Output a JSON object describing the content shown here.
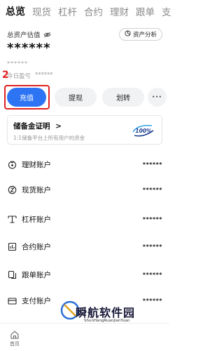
{
  "tabs": [
    "总览",
    "现货",
    "杠杆",
    "合约",
    "理财",
    "跟单",
    "支"
  ],
  "header": {
    "total_label": "总资产估值",
    "analysis_label": "资产分析",
    "masked_value": "******",
    "masked_small": "******",
    "pnl_label": "今日盈亏",
    "pnl_value": "******"
  },
  "annotation": {
    "step": "2"
  },
  "actions": {
    "recharge": "充值",
    "withdraw": "提现",
    "transfer": "划转",
    "more": "···"
  },
  "reserve": {
    "title": "储备金证明",
    "chevron": ">",
    "subtitle": "1:1储备平台上所有用户的资金",
    "badge": "100%"
  },
  "accounts": [
    {
      "name": "理财账户",
      "value": "******",
      "icon": "savings-icon"
    },
    {
      "name": "现货账户",
      "value": "******",
      "icon": "spot-icon"
    },
    {
      "name": "杠杆账户",
      "value": "******",
      "icon": "margin-icon"
    },
    {
      "name": "合约账户",
      "value": "******",
      "icon": "futures-icon"
    },
    {
      "name": "跟单账户",
      "value": "******",
      "icon": "copytrade-icon"
    },
    {
      "name": "支付账户",
      "value": "******",
      "icon": "payment-icon"
    }
  ],
  "bottom_nav": {
    "home": "首页"
  },
  "watermark": {
    "text": "瞬航软件园",
    "sub": "ShunHangRuanJianYuan"
  },
  "colors": {
    "accent": "#2d74f5",
    "highlight": "#e02020"
  }
}
